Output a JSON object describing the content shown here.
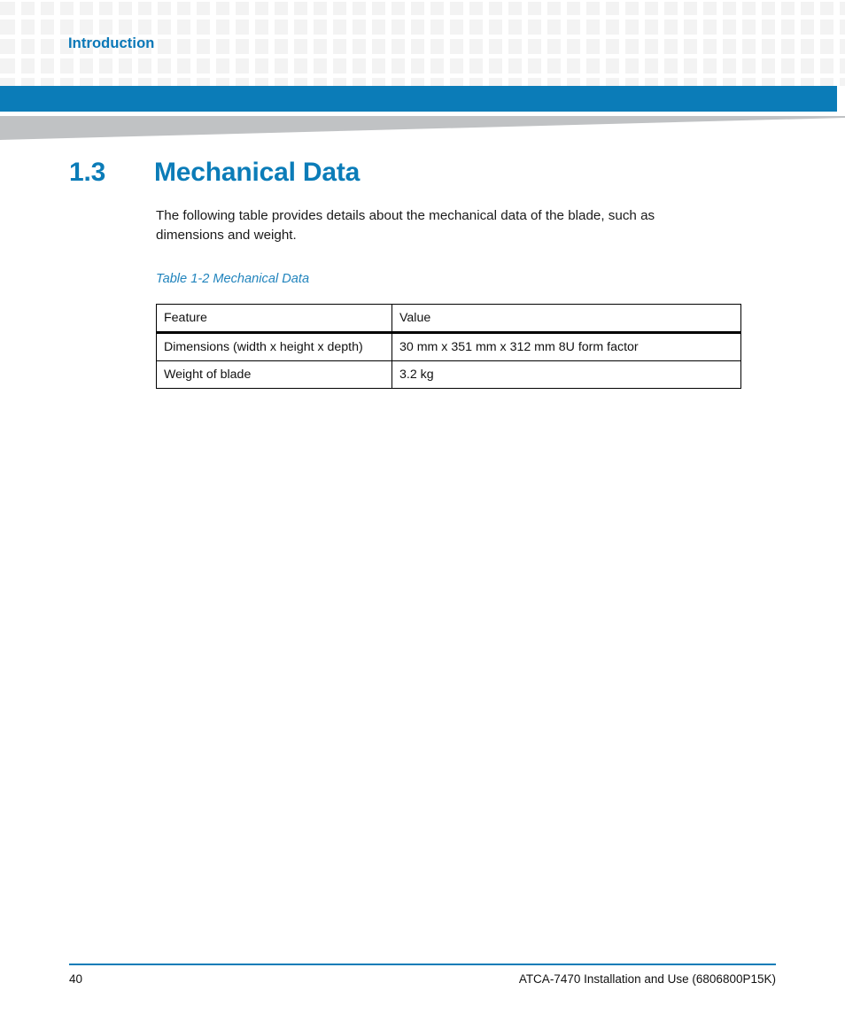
{
  "header": {
    "running_head": "Introduction",
    "accent_color": "#0b7cb8",
    "band_color": "#0b7cb8",
    "wedge_color": "#c0c2c4",
    "grid_square_color": "#f3f3f3"
  },
  "section": {
    "number": "1.3",
    "title": "Mechanical Data",
    "paragraph": "The following table provides details about the mechanical data of the blade, such as dimensions and weight."
  },
  "table": {
    "caption": "Table 1-2 Mechanical Data",
    "columns": [
      "Feature",
      "Value"
    ],
    "rows": [
      [
        "Dimensions (width x height x depth)",
        "30 mm x 351 mm x 312 mm 8U form factor"
      ],
      [
        "Weight of blade",
        "3.2 kg"
      ]
    ]
  },
  "footer": {
    "page_number": "40",
    "document_title": "ATCA-7470 Installation and Use (6806800P15K)",
    "rule_color": "#0b7cb8"
  }
}
